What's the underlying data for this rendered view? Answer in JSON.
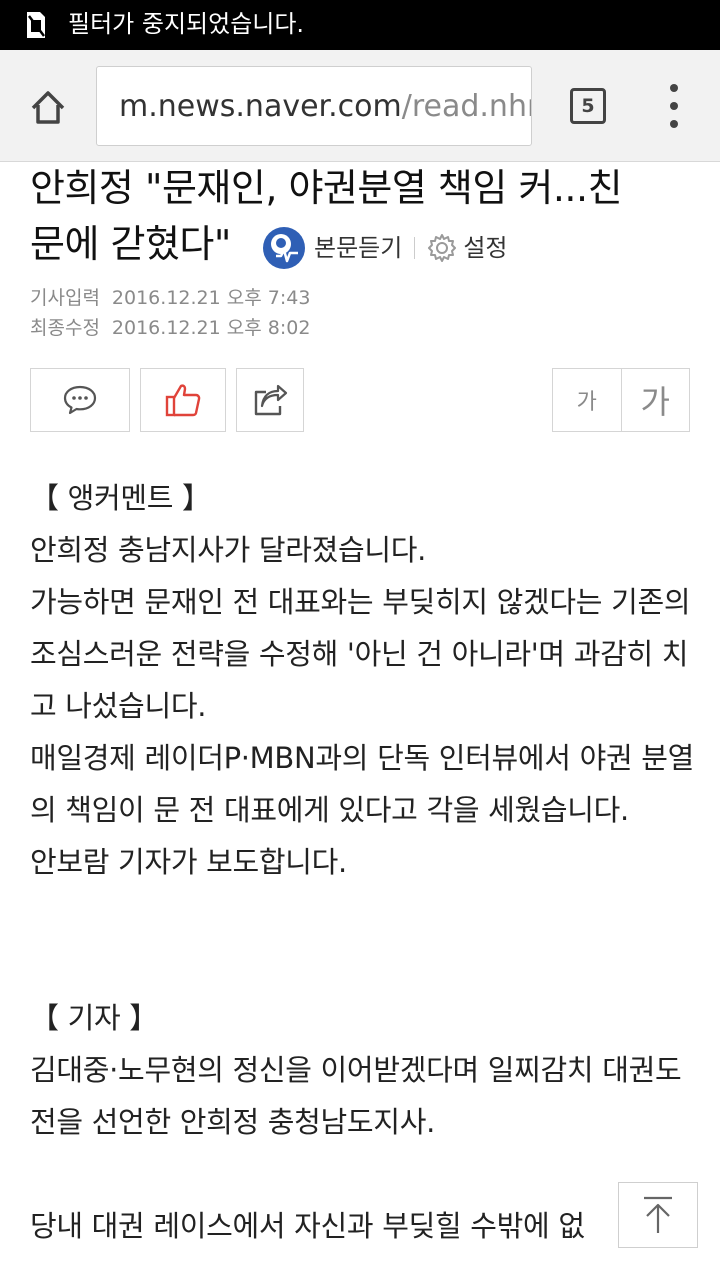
{
  "status_bar": {
    "notification_text": "필터가 중지되었습니다.",
    "icon": "no-sim-icon"
  },
  "browser": {
    "url_host": "m.news.naver.com",
    "url_path": "/read.nhn",
    "tab_count": "5",
    "icons": [
      "home-icon",
      "more-vert-icon"
    ]
  },
  "article": {
    "title_line1": "안희정 \"문재인, 야권분열 책임 커...친",
    "title_line2": "문에 갇혔다\"",
    "listen_label": "본문듣기",
    "settings_label": "설정",
    "meta": {
      "input_label": "기사입력",
      "input_value": "2016.12.21 오후 7:43",
      "modified_label": "최종수정",
      "modified_value": "2016.12.21 오후 8:02"
    },
    "font_small": "가",
    "font_large": "가",
    "body": [
      "【 앵커멘트 】",
      "안희정 충남지사가 달라졌습니다.",
      "가능하면 문재인 전 대표와는 부딪히지 않겠다는 기존의 조심스러운 전략을 수정해 '아닌 건 아니라'며 과감히 치고 나섰습니다.",
      "매일경제 레이더P·MBN과의 단독 인터뷰에서 야권 분열의 책임이 문 전 대표에게 있다고 각을 세웠습니다.",
      "안보람 기자가 보도합니다.",
      "【 기자 】",
      "김대중·노무현의 정신을 이어받겠다며 일찌감치 대권도전을 선언한 안희정 충청남도지사.",
      "당내 대권 레이스에서 자신과 부딪힐 수밖에 없"
    ]
  },
  "colors": {
    "status_bar_bg": "#000000",
    "toolbar_bg": "#f2f2f2",
    "like_red": "#e0433a",
    "listen_blue": "#2f5fb5"
  }
}
